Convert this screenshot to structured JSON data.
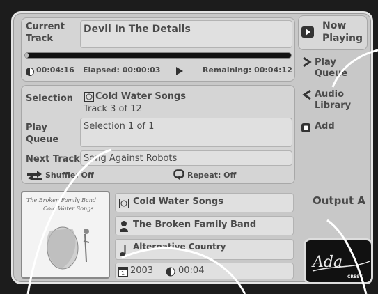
{
  "now_playing": {
    "current_track_label": "Current Track",
    "title": "Devil In The Details",
    "total_time": "00:04:16",
    "elapsed": "Elapsed: 00:00:03",
    "remaining": "Remaining: 00:04:12",
    "progress": 0.012
  },
  "selection": {
    "label": "Selection",
    "album": "Cold Water Songs",
    "track_info": "Track 3 of 12",
    "play_queue_label": "Play Queue",
    "play_queue_value": "Selection 1 of 1",
    "next_track_label": "Next Track",
    "next_track_value": "Song Against Robots",
    "shuffle": "Shuffle: Off",
    "repeat": "Repeat: Off"
  },
  "details": {
    "album": "Cold Water Songs",
    "artist": "The Broken Family Band",
    "genre": "Alternative Country",
    "year": "2003",
    "time": "00:04",
    "album_art_caption": "The Broken Family Band — Cold Water Songs"
  },
  "nav": {
    "now_playing": "Now Playing",
    "play_queue": "Play Queue",
    "audio_library": "Audio Library",
    "add": "Add"
  },
  "output": "Output A",
  "logo": "Adagio Crestron"
}
